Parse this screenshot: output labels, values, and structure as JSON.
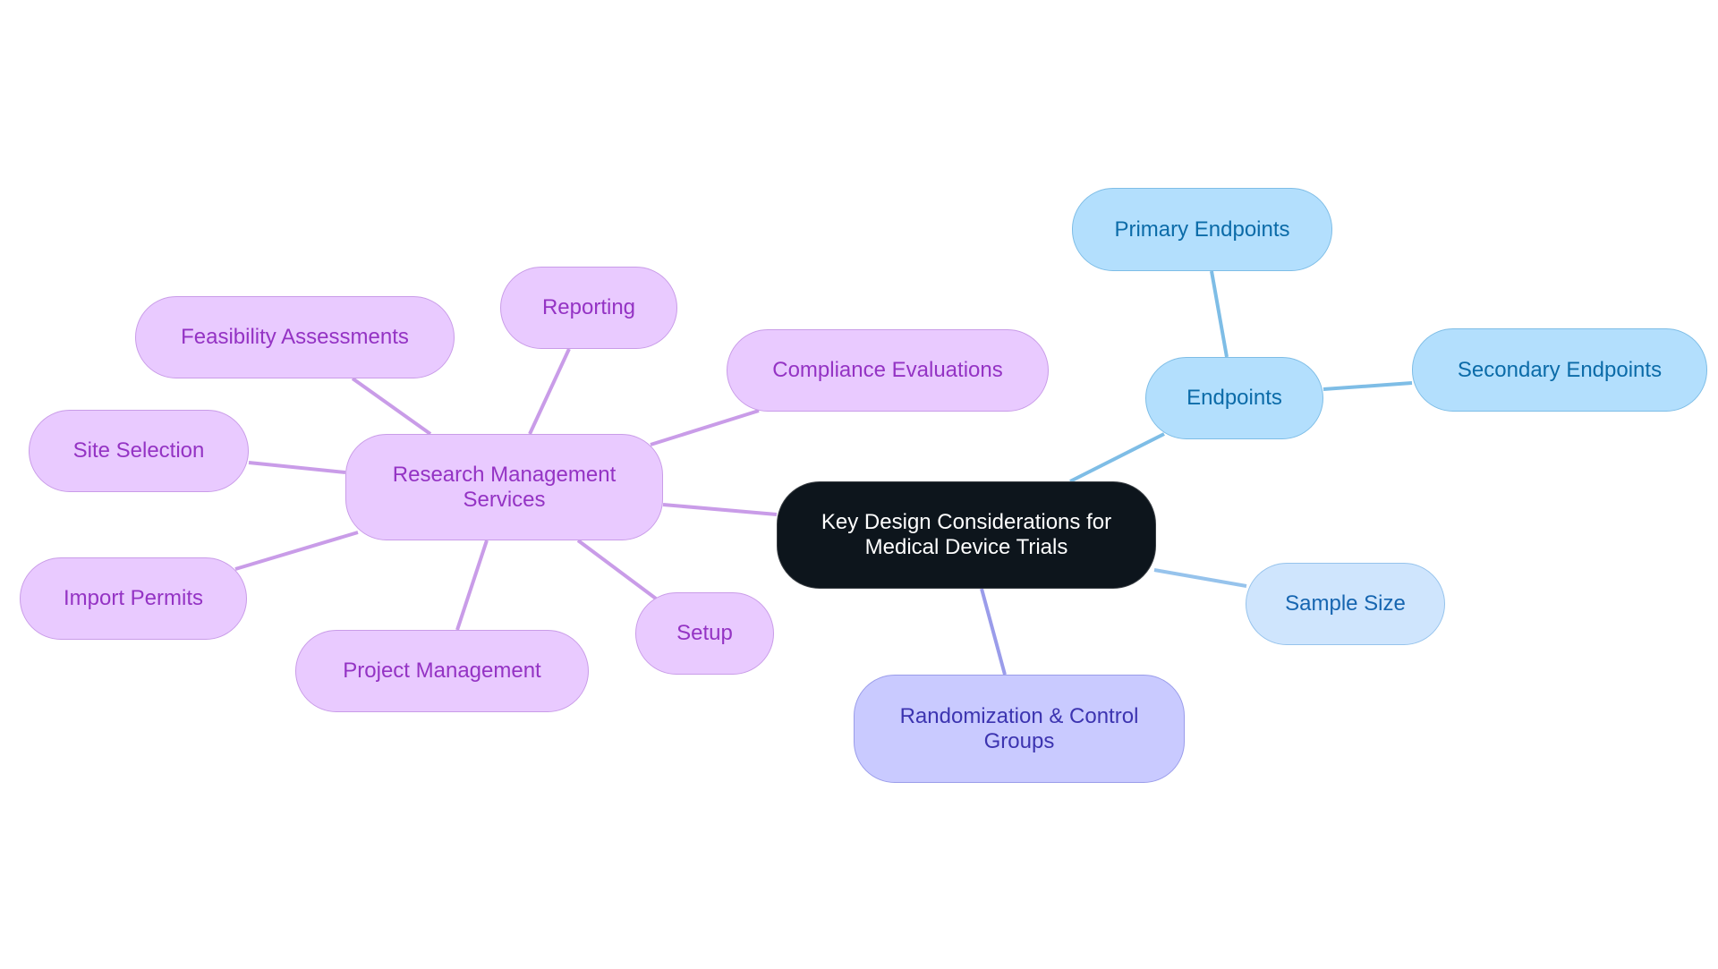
{
  "diagram": {
    "type": "mindmap",
    "colors": {
      "root_fill": "#0d151c",
      "root_text": "#ffffff",
      "purple_fill": "#e9caff",
      "purple_text": "#9433c4",
      "purple_edge": "#c99ce8",
      "blue_fill": "#b3dffd",
      "blue_text": "#0b6ba8",
      "blue_edge": "#7ebde6",
      "light_blue_fill": "#cfe5fd",
      "light_blue_edge": "#96c3ec",
      "indigo_fill": "#c9caff",
      "indigo_text": "#3c34b0",
      "indigo_edge": "#9a9cea"
    },
    "root": {
      "id": "root",
      "lines": [
        "Key Design Considerations for",
        "Medical Device Trials"
      ]
    },
    "nodes": [
      {
        "id": "rms",
        "parent": "root",
        "lines": [
          "Research Management",
          "Services"
        ]
      },
      {
        "id": "compliance",
        "parent": "rms",
        "lines": [
          "Compliance Evaluations"
        ]
      },
      {
        "id": "reporting",
        "parent": "rms",
        "lines": [
          "Reporting"
        ]
      },
      {
        "id": "feasibility",
        "parent": "rms",
        "lines": [
          "Feasibility Assessments"
        ]
      },
      {
        "id": "site",
        "parent": "rms",
        "lines": [
          "Site Selection"
        ]
      },
      {
        "id": "import",
        "parent": "rms",
        "lines": [
          "Import Permits"
        ]
      },
      {
        "id": "project",
        "parent": "rms",
        "lines": [
          "Project Management"
        ]
      },
      {
        "id": "setup",
        "parent": "rms",
        "lines": [
          "Setup"
        ]
      },
      {
        "id": "endpoints",
        "parent": "root",
        "lines": [
          "Endpoints"
        ]
      },
      {
        "id": "primary",
        "parent": "endpoints",
        "lines": [
          "Primary Endpoints"
        ]
      },
      {
        "id": "secondary",
        "parent": "endpoints",
        "lines": [
          "Secondary Endpoints"
        ]
      },
      {
        "id": "sample",
        "parent": "root",
        "lines": [
          "Sample Size"
        ]
      },
      {
        "id": "random",
        "parent": "root",
        "lines": [
          "Randomization & Control",
          "Groups"
        ]
      }
    ]
  }
}
